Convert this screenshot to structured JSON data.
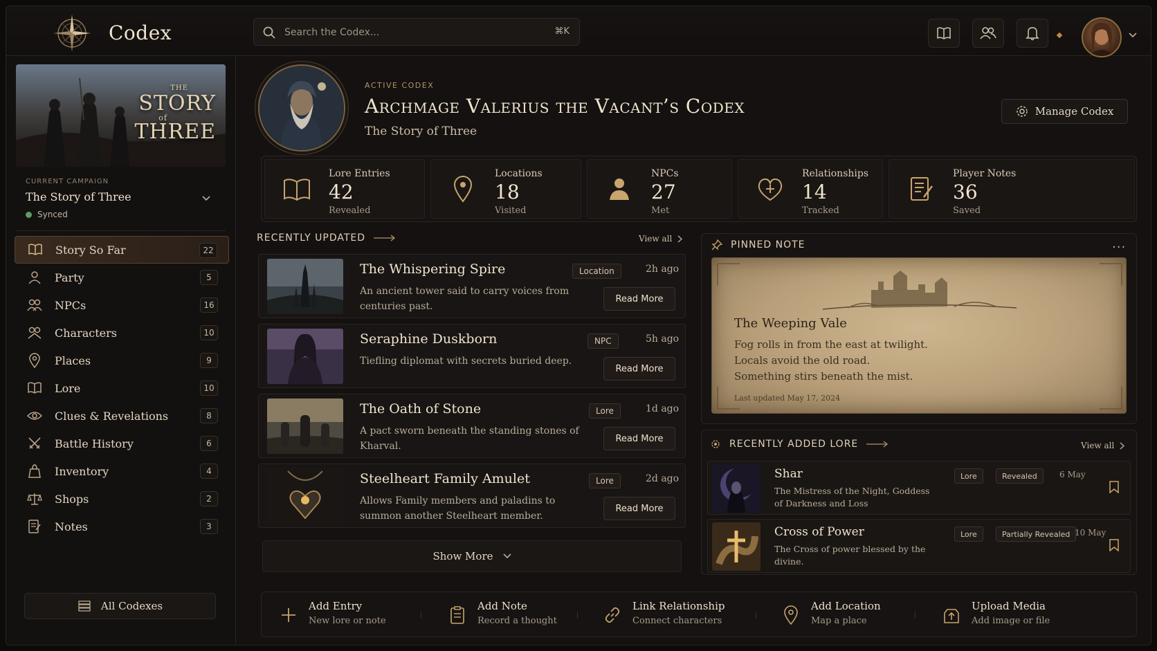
{
  "app": {
    "title": "Codex"
  },
  "search": {
    "placeholder": "Search the Codex...",
    "shortcut": "⌘K"
  },
  "sidebar": {
    "cover_title_small": "THE",
    "cover_title_1": "STORY",
    "cover_title_of": "of",
    "cover_title_2": "THREE",
    "campaign_label": "CURRENT CAMPAIGN",
    "campaign_name": "The Story of Three",
    "sync_status": "Synced",
    "items": [
      {
        "label": "Story So Far",
        "count": "22",
        "icon": "open-book-icon"
      },
      {
        "label": "Party",
        "count": "5",
        "icon": "person-icon"
      },
      {
        "label": "NPCs",
        "count": "16",
        "icon": "people-icon"
      },
      {
        "label": "Characters",
        "count": "10",
        "icon": "characters-icon"
      },
      {
        "label": "Places",
        "count": "9",
        "icon": "map-pin-icon"
      },
      {
        "label": "Lore",
        "count": "10",
        "icon": "book-icon"
      },
      {
        "label": "Clues & Revelations",
        "count": "8",
        "icon": "eye-icon"
      },
      {
        "label": "Battle History",
        "count": "6",
        "icon": "crossed-swords-icon"
      },
      {
        "label": "Inventory",
        "count": "4",
        "icon": "bag-icon"
      },
      {
        "label": "Shops",
        "count": "2",
        "icon": "scales-icon"
      },
      {
        "label": "Notes",
        "count": "3",
        "icon": "note-icon"
      }
    ],
    "all_codexes": "All Codexes"
  },
  "header": {
    "active_label": "ACTIVE CODEX",
    "title": "Archmage Valerius the Vacant’s Codex",
    "subtitle": "The Story of Three",
    "manage_label": "Manage Codex"
  },
  "stats": [
    {
      "label": "Lore Entries",
      "value": "42",
      "sub": "Revealed",
      "icon": "open-book-icon"
    },
    {
      "label": "Locations",
      "value": "18",
      "sub": "Visited",
      "icon": "map-pin-icon"
    },
    {
      "label": "NPCs",
      "value": "27",
      "sub": "Met",
      "icon": "person-icon"
    },
    {
      "label": "Relationships",
      "value": "14",
      "sub": "Tracked",
      "icon": "heart-link-icon"
    },
    {
      "label": "Player Notes",
      "value": "36",
      "sub": "Saved",
      "icon": "note-pen-icon"
    }
  ],
  "recently_updated": {
    "heading": "RECENTLY UPDATED",
    "view_all": "View all",
    "items": [
      {
        "title": "The Whispering Spire",
        "desc": "An ancient tower said to carry voices from centuries past.",
        "tag": "Location",
        "time": "2h ago",
        "action": "Read More"
      },
      {
        "title": "Seraphine Duskborn",
        "desc": "Tiefling diplomat with secrets buried deep.",
        "tag": "NPC",
        "time": "5h ago",
        "action": "Read More"
      },
      {
        "title": "The Oath of Stone",
        "desc": "A pact sworn beneath the standing stones of Kharval.",
        "tag": "Lore",
        "time": "1d ago",
        "action": "Read More"
      },
      {
        "title": "Steelheart Family Amulet",
        "desc": "Allows Family members and paladins to summon another Steelheart member.",
        "tag": "Lore",
        "time": "2d ago",
        "action": "Read More"
      }
    ],
    "show_more": "Show More"
  },
  "pinned_note": {
    "heading": "PINNED NOTE",
    "title": "The Weeping Vale",
    "lines": [
      "Fog rolls in from the east at twilight.",
      "Locals avoid the old road.",
      "Something stirs beneath the mist."
    ],
    "updated": "Last updated May 17, 2024"
  },
  "recently_added_lore": {
    "heading": "RECENTLY ADDED LORE",
    "view_all": "View all",
    "items": [
      {
        "title": "Shar",
        "desc": "The Mistress of the Night, Goddess of Darkness and Loss",
        "tag": "Lore",
        "status": "Revealed",
        "date": "6 May"
      },
      {
        "title": "Cross of Power",
        "desc": "The Cross of power blessed by the divine.",
        "tag": "Lore",
        "status": "Partially Revealed",
        "date": "10 May"
      }
    ]
  },
  "actions": [
    {
      "title": "Add Entry",
      "sub": "New lore or note",
      "icon": "plus-icon"
    },
    {
      "title": "Add Note",
      "sub": "Record a thought",
      "icon": "clipboard-icon"
    },
    {
      "title": "Link Relationship",
      "sub": "Connect characters",
      "icon": "link-icon"
    },
    {
      "title": "Add Location",
      "sub": "Map a place",
      "icon": "map-pin-icon"
    },
    {
      "title": "Upload Media",
      "sub": "Add image or file",
      "icon": "upload-icon"
    }
  ],
  "colors": {
    "accent": "#c68a3c",
    "background": "#141110",
    "text": "#e8dcc8",
    "synced": "#5c9c62"
  }
}
